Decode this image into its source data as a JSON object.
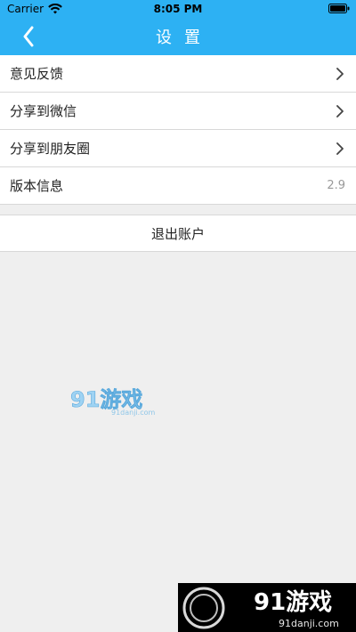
{
  "status_bar": {
    "carrier": "Carrier",
    "time": "8:05 PM"
  },
  "header": {
    "title": "设置",
    "back_icon": "chevron-left-icon"
  },
  "menu_items": [
    {
      "label": "意见反馈",
      "icon": "chevron-right-icon"
    },
    {
      "label": "分享到微信",
      "icon": "chevron-right-icon"
    },
    {
      "label": "分享到朋友圈",
      "icon": "chevron-right-icon"
    },
    {
      "label": "版本信息",
      "value": "2.9"
    }
  ],
  "logout_label": "退出账户",
  "watermark": {
    "brand": "91游戏",
    "url": "91danji.com"
  },
  "colors": {
    "header_bg": "#2db1f3",
    "page_bg": "#efefef"
  }
}
